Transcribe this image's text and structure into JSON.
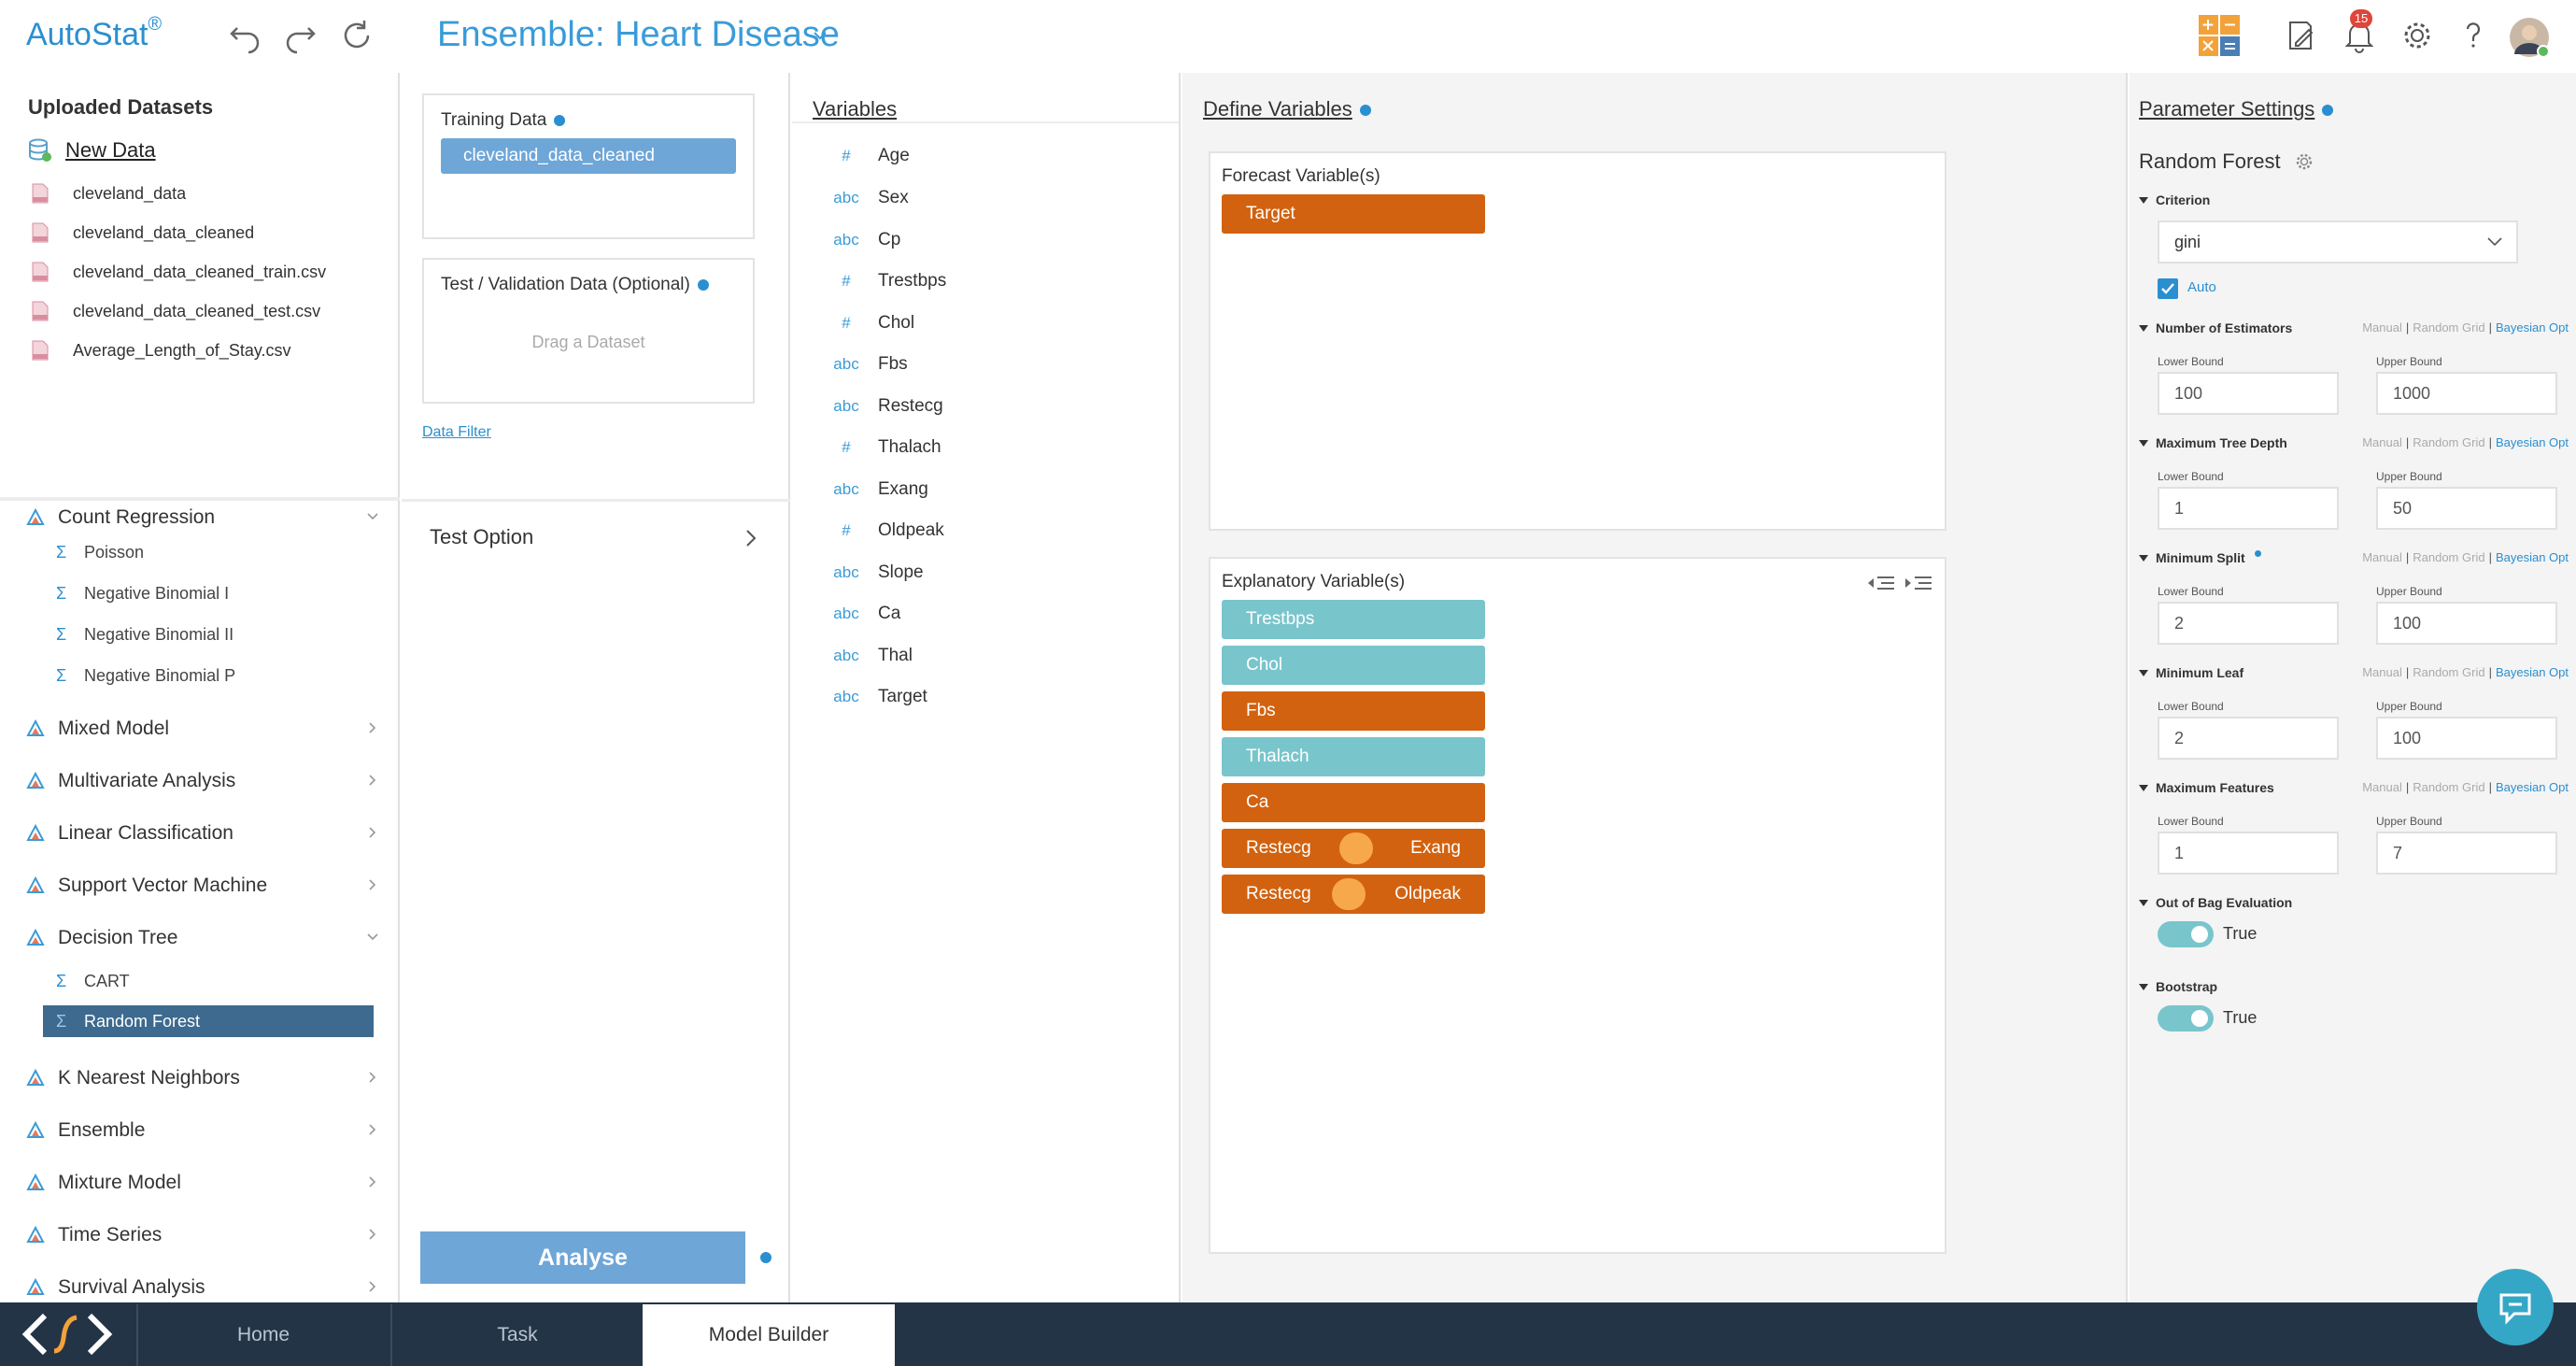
{
  "header": {
    "app_name": "AutoStat",
    "app_mark": "®",
    "page_title": "Ensemble: Heart Disease",
    "notification_count": "15"
  },
  "datasets": {
    "heading": "Uploaded Datasets",
    "new_data_label": "New Data",
    "files": [
      "cleveland_data",
      "cleveland_data_cleaned",
      "cleveland_data_cleaned_train.csv",
      "cleveland_data_cleaned_test.csv",
      "Average_Length_of_Stay.csv"
    ]
  },
  "model_tree": {
    "items": [
      {
        "label": "Count Regression",
        "kind": "category",
        "expanded": true
      },
      {
        "label": "Poisson",
        "kind": "model"
      },
      {
        "label": "Negative Binomial I",
        "kind": "model"
      },
      {
        "label": "Negative Binomial II",
        "kind": "model"
      },
      {
        "label": "Negative Binomial P",
        "kind": "model"
      },
      {
        "label": "Mixed Model",
        "kind": "category"
      },
      {
        "label": "Multivariate Analysis",
        "kind": "category"
      },
      {
        "label": "Linear Classification",
        "kind": "category"
      },
      {
        "label": "Support Vector Machine",
        "kind": "category"
      },
      {
        "label": "Decision Tree",
        "kind": "category",
        "expanded": true
      },
      {
        "label": "CART",
        "kind": "model"
      },
      {
        "label": "Random Forest",
        "kind": "model",
        "selected": true
      },
      {
        "label": "K Nearest Neighbors",
        "kind": "category"
      },
      {
        "label": "Ensemble",
        "kind": "category"
      },
      {
        "label": "Mixture Model",
        "kind": "category"
      },
      {
        "label": "Time Series",
        "kind": "category"
      },
      {
        "label": "Survival Analysis",
        "kind": "category"
      }
    ]
  },
  "data_panel": {
    "training_label": "Training Data",
    "training_dataset": "cleveland_data_cleaned",
    "test_label": "Test / Validation Data (Optional)",
    "test_placeholder": "Drag a Dataset",
    "data_filter": "Data Filter",
    "test_option": "Test Option",
    "analyse": "Analyse"
  },
  "variables_panel": {
    "title": "Variables",
    "items": [
      {
        "type": "#",
        "name": "Age"
      },
      {
        "type": "abc",
        "name": "Sex"
      },
      {
        "type": "abc",
        "name": "Cp"
      },
      {
        "type": "#",
        "name": "Trestbps"
      },
      {
        "type": "#",
        "name": "Chol"
      },
      {
        "type": "abc",
        "name": "Fbs"
      },
      {
        "type": "abc",
        "name": "Restecg"
      },
      {
        "type": "#",
        "name": "Thalach"
      },
      {
        "type": "abc",
        "name": "Exang"
      },
      {
        "type": "#",
        "name": "Oldpeak"
      },
      {
        "type": "abc",
        "name": "Slope"
      },
      {
        "type": "abc",
        "name": "Ca"
      },
      {
        "type": "abc",
        "name": "Thal"
      },
      {
        "type": "abc",
        "name": "Target"
      }
    ]
  },
  "define_panel": {
    "title": "Define Variables",
    "forecast_label": "Forecast Variable(s)",
    "forecast": [
      {
        "label": "Target",
        "color": "orange"
      }
    ],
    "explanatory_label": "Explanatory Variable(s)",
    "explanatory": [
      {
        "label": "Trestbps",
        "color": "teal"
      },
      {
        "label": "Chol",
        "color": "teal"
      },
      {
        "label": "Fbs",
        "color": "orange"
      },
      {
        "label": "Thalach",
        "color": "teal"
      },
      {
        "label": "Ca",
        "color": "orange"
      },
      {
        "label": "Restecg",
        "label2": "Exang",
        "color": "orange",
        "interaction": true
      },
      {
        "label": "Restecg",
        "label2": "Oldpeak",
        "color": "orange",
        "interaction": true
      }
    ]
  },
  "params": {
    "title": "Parameter Settings",
    "model": "Random Forest",
    "criterion_label": "Criterion",
    "criterion_value": "gini",
    "auto_label": "Auto",
    "mode_manual": "Manual",
    "mode_random": "Random Grid",
    "mode_bayes": "Bayesian Opt",
    "lower_label": "Lower Bound",
    "upper_label": "Upper Bound",
    "n_estimators": {
      "label": "Number of Estimators",
      "lower": "100",
      "upper": "1000"
    },
    "max_depth": {
      "label": "Maximum Tree Depth",
      "lower": "1",
      "upper": "50"
    },
    "min_split": {
      "label": "Minimum Split",
      "lower": "2",
      "upper": "100"
    },
    "min_leaf": {
      "label": "Minimum Leaf",
      "lower": "2",
      "upper": "100"
    },
    "max_features": {
      "label": "Maximum Features",
      "lower": "1",
      "upper": "7"
    },
    "oob": {
      "label": "Out of Bag Evaluation",
      "value": "True"
    },
    "bootstrap": {
      "label": "Bootstrap",
      "value": "True"
    }
  },
  "taskbar": {
    "tabs": [
      "Home",
      "Task",
      "Model Builder"
    ],
    "active_tab": "Model Builder"
  },
  "colors": {
    "accent": "#2a8fd0",
    "chip_orange": "#d2620f",
    "chip_teal": "#79c5cc",
    "taskbar": "#243447"
  }
}
